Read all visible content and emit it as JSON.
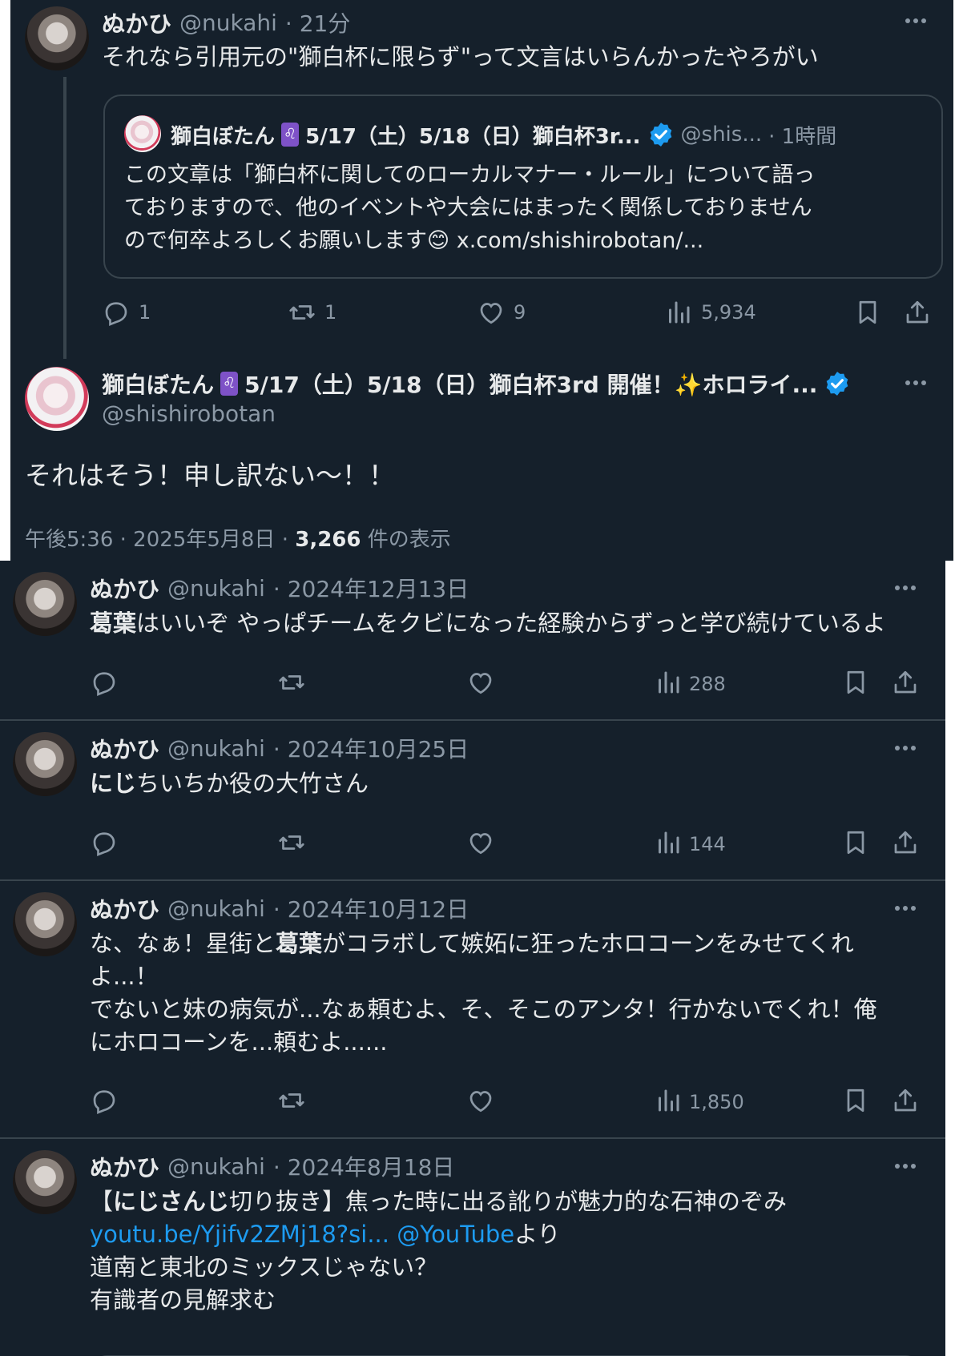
{
  "colors": {
    "background": "#15202b",
    "text": "#e7e9ea",
    "muted": "#8b98a5",
    "accent": "#1d9bf0",
    "border": "#38444d"
  },
  "thread": {
    "reply": {
      "author": "ぬかひ",
      "handle": "@nukahi",
      "time": "· 21分",
      "text": "それなら引用元の\"獅白杯に限らず\"って文言はいらんかったやろがい",
      "quote": {
        "author": "獅白ぼたん",
        "zodiac": "♌",
        "author_suffix": "5/17（土）5/18（日）獅白杯3r...",
        "handle": "@shis...",
        "time": "· 1時間",
        "lines": [
          "この文章は「獅白杯に関してのローカルマナー・ルール」について語っ",
          "ておりますので、他のイベントや大会にはまったく関係しておりません",
          "ので何卒よろしくお願いします"
        ],
        "emoji": "😊",
        "link": "x.com/shishirobotan/..."
      },
      "stats": {
        "replies": "1",
        "reposts": "1",
        "likes": "9",
        "views": "5,934"
      }
    },
    "main": {
      "author": "獅白ぼたん",
      "zodiac": "♌",
      "author_suffix": "5/17（土）5/18（日）獅白杯3rd 開催！✨ホロライ...",
      "handle": "@shishirobotan",
      "text": "それはそう！申し訳ない～！！",
      "time": "午後5:36 · 2025年5月8日 · ",
      "views": "3,266",
      "views_label": " 件の表示"
    }
  },
  "posts": [
    {
      "author": "ぬかひ",
      "handle": "@nukahi",
      "time": "· 2024年12月13日",
      "lines": [
        [
          {
            "t": "葛葉",
            "b": true
          },
          {
            "t": "はいいぞ やっぱチームをクビになった経験からずっと学び続けているよ"
          }
        ]
      ],
      "views": "288"
    },
    {
      "author": "ぬかひ",
      "handle": "@nukahi",
      "time": "· 2024年10月25日",
      "lines": [
        [
          {
            "t": "にじ",
            "b": true
          },
          {
            "t": "ちいちか役の大竹さん"
          }
        ]
      ],
      "views": "144"
    },
    {
      "author": "ぬかひ",
      "handle": "@nukahi",
      "time": "· 2024年10月12日",
      "lines": [
        [
          {
            "t": "な、なぁ！星街と"
          },
          {
            "t": "葛葉",
            "b": true
          },
          {
            "t": "がコラボして嫉妬に狂ったホロコーンをみせてくれ"
          }
        ],
        [
          {
            "t": "よ...！"
          }
        ],
        [
          {
            "t": "でないと妹の病気が...なぁ頼むよ、そ、そこのアンタ！行かないでくれ！俺"
          }
        ],
        [
          {
            "t": "にホロコーンを...頼むよ......"
          }
        ]
      ],
      "views": "1,850"
    },
    {
      "author": "ぬかひ",
      "handle": "@nukahi",
      "time": "· 2024年8月18日",
      "lines": [
        [
          {
            "t": "【"
          },
          {
            "t": "にじさんじ",
            "b": true
          },
          {
            "t": "切り抜き】焦った時に出る訛りが魅力的な石神のぞみ"
          }
        ],
        [
          {
            "t": "youtu.be/Yjifv2ZMj18?si...",
            "l": true
          },
          {
            "t": " "
          },
          {
            "t": "@YouTube",
            "l": true
          },
          {
            "t": "より"
          }
        ],
        [
          {
            "t": "道南と東北のミックスじゃない？"
          }
        ],
        [
          {
            "t": "有識者の見解求む"
          }
        ]
      ],
      "views": ""
    }
  ]
}
